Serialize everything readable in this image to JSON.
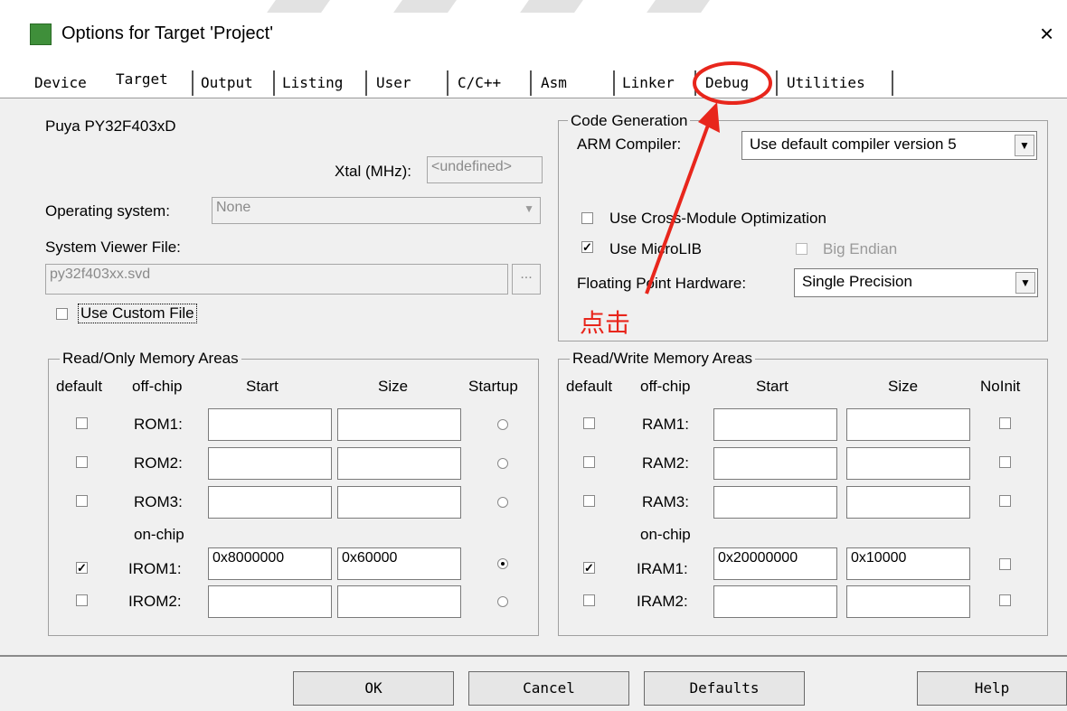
{
  "window": {
    "title": "Options for Target 'Project'",
    "close_symbol": "×"
  },
  "tabs": [
    "Device",
    "Target",
    "Output",
    "Listing",
    "User",
    "C/C++",
    "Asm",
    "Linker",
    "Debug",
    "Utilities"
  ],
  "device": {
    "name": "Puya PY32F403xD",
    "xtal_label": "Xtal (MHz):",
    "xtal_value": "<undefined>"
  },
  "os": {
    "label": "Operating system:",
    "value": "None"
  },
  "svd": {
    "label": "System Viewer File:",
    "value": "py32f403xx.svd",
    "browse": "...",
    "custom_label": "Use Custom File"
  },
  "codegen": {
    "group_title": "Code Generation",
    "compiler_label": "ARM Compiler:",
    "compiler_value": "Use default compiler version 5",
    "cross_module_label": "Use Cross-Module Optimization",
    "microlib_label": "Use MicroLIB",
    "big_endian_label": "Big Endian",
    "fp_label": "Floating Point Hardware:",
    "fp_value": "Single Precision"
  },
  "annotation": {
    "text": "点击",
    "color": "#e8261c"
  },
  "rom": {
    "group_title": "Read/Only Memory Areas",
    "headers": {
      "default": "default",
      "offchip": "off-chip",
      "start": "Start",
      "size": "Size",
      "last": "Startup"
    },
    "onchip_label": "on-chip",
    "rows": [
      {
        "label": "ROM1:",
        "start": "",
        "size": ""
      },
      {
        "label": "ROM2:",
        "start": "",
        "size": ""
      },
      {
        "label": "ROM3:",
        "start": "",
        "size": ""
      },
      {
        "label": "IROM1:",
        "start": "0x8000000",
        "size": "0x60000"
      },
      {
        "label": "IROM2:",
        "start": "",
        "size": ""
      }
    ]
  },
  "ram": {
    "group_title": "Read/Write Memory Areas",
    "headers": {
      "default": "default",
      "offchip": "off-chip",
      "start": "Start",
      "size": "Size",
      "last": "NoInit"
    },
    "onchip_label": "on-chip",
    "rows": [
      {
        "label": "RAM1:",
        "start": "",
        "size": ""
      },
      {
        "label": "RAM2:",
        "start": "",
        "size": ""
      },
      {
        "label": "RAM3:",
        "start": "",
        "size": ""
      },
      {
        "label": "IRAM1:",
        "start": "0x20000000",
        "size": "0x10000"
      },
      {
        "label": "IRAM2:",
        "start": "",
        "size": ""
      }
    ]
  },
  "buttons": {
    "ok": "OK",
    "cancel": "Cancel",
    "defaults": "Defaults",
    "help": "Help"
  }
}
